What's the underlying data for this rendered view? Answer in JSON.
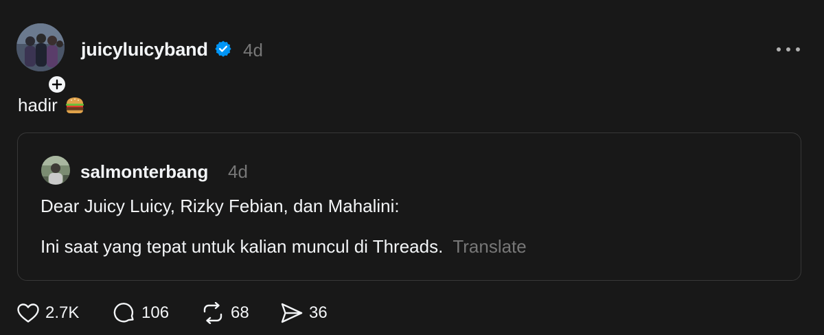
{
  "author": {
    "username": "juicyluicyband",
    "timestamp": "4d",
    "verified": true
  },
  "post": {
    "text": "hadir",
    "emoji_icon": "hamburger-emoji"
  },
  "quoted_post": {
    "username": "salmonterbang",
    "timestamp": "4d",
    "line1": "Dear Juicy Luicy, Rizky Febian, dan Mahalini:",
    "line2": "Ini saat yang tepat untuk kalian muncul di Threads.",
    "translate_label": "Translate"
  },
  "actions": {
    "likes": "2.7K",
    "replies": "106",
    "reposts": "68",
    "shares": "36"
  },
  "colors": {
    "background": "#181818",
    "text": "#f3f5f7",
    "muted": "#777777",
    "border": "#383838",
    "verified": "#0095f6"
  }
}
